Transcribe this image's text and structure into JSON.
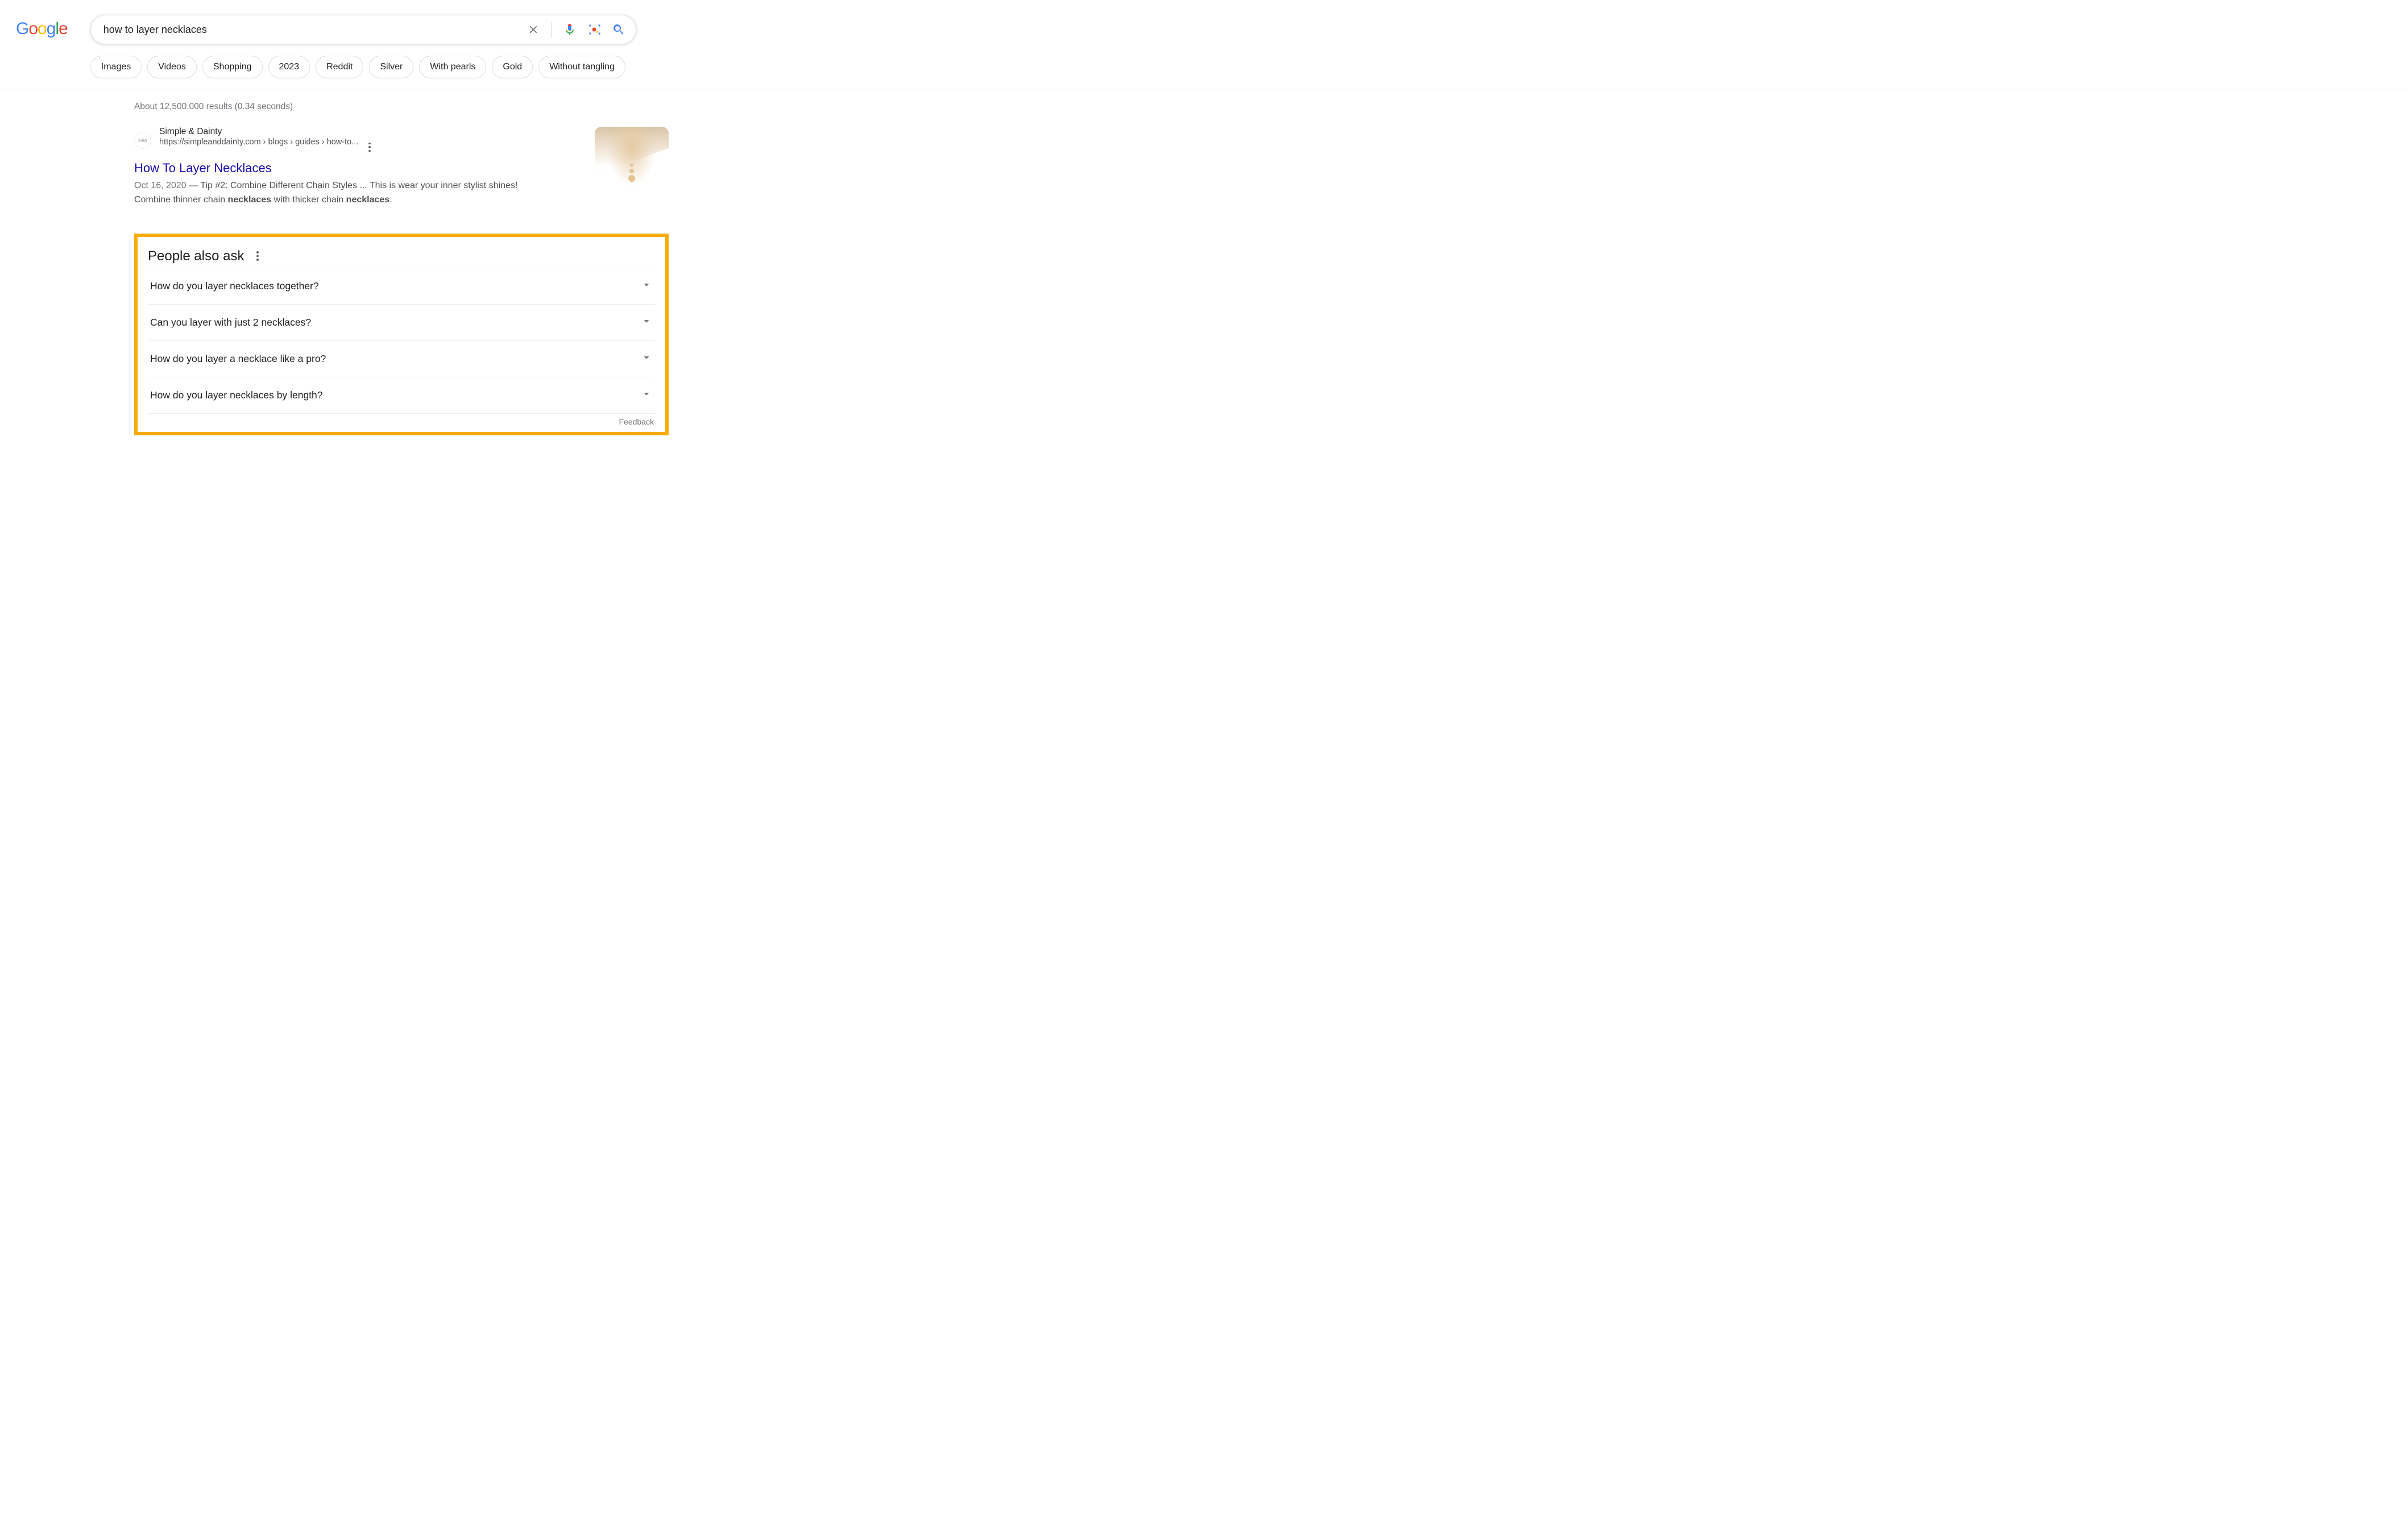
{
  "search": {
    "query": "how to layer necklaces"
  },
  "chips": [
    "Images",
    "Videos",
    "Shopping",
    "2023",
    "Reddit",
    "Silver",
    "With pearls",
    "Gold",
    "Without tangling"
  ],
  "stats": "About 12,500,000 results (0.34 seconds)",
  "result": {
    "site_name": "Simple & Dainty",
    "url_display": "https://simpleanddainty.com › blogs › guides › how-to...",
    "title": "How To Layer Necklaces",
    "date": "Oct 16, 2020",
    "snippet_pre": "Tip #2: Combine Different Chain Styles ... This is wear your inner stylist shines! Combine thinner chain ",
    "kw1": "necklaces",
    "snippet_mid": " with thicker chain ",
    "kw2": "necklaces",
    "snippet_end": "."
  },
  "paa": {
    "title": "People also ask",
    "items": [
      "How do you layer necklaces together?",
      "Can you layer with just 2 necklaces?",
      "How do you layer a necklace like a pro?",
      "How do you layer necklaces by length?"
    ],
    "feedback": "Feedback"
  }
}
